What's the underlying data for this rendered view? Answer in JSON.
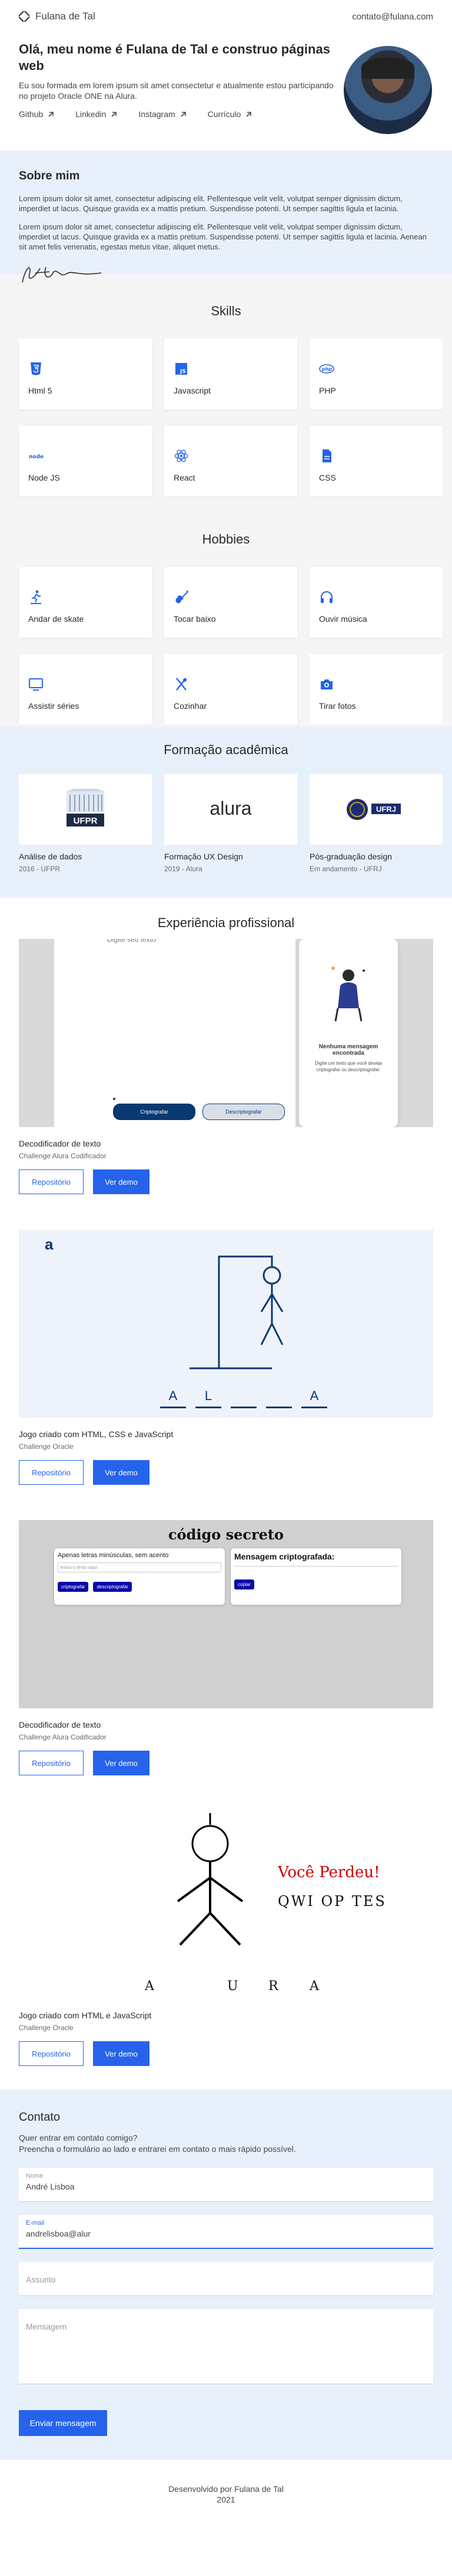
{
  "header": {
    "brand": "Fulana de Tal",
    "email": "contato@fulana.com"
  },
  "hero": {
    "title": "Olá, meu nome é Fulana de Tal e construo páginas web",
    "text": "Eu sou formada em lorem ipsum sit amet consectetur e atualmente estou participando no projeto Oracle ONE na Alura.",
    "links": [
      "Github",
      "Linkedin",
      "Instagram",
      "Currículo"
    ]
  },
  "about": {
    "title": "Sobre mim",
    "p1": "Lorem ipsum dolor sit amet, consectetur adipiscing elit. Pellentesque velit velit, volutpat semper dignissim dictum, imperdiet ut lacus. Quisque gravida ex a mattis pretium. Suspendisse potenti. Ut semper sagittis ligula et lacinia.",
    "p2": "Lorem ipsum dolor sit amet, consectetur adipiscing elit. Pellentesque velit velit, volutpat semper dignissim dictum, imperdiet ut lacus. Quisque gravida ex a mattis pretium. Suspendisse potenti. Ut semper sagittis ligula et lacinia. Aenean sit amet felis venenatis, egestas metus vitae, aliquet metus."
  },
  "skills": {
    "title": "Skills",
    "items": [
      {
        "label": "Html 5",
        "icon": "html5-icon"
      },
      {
        "label": "Javascript",
        "icon": "javascript-icon"
      },
      {
        "label": "PHP",
        "icon": "php-icon"
      },
      {
        "label": "Node JS",
        "icon": "nodejs-icon"
      },
      {
        "label": "React",
        "icon": "react-icon"
      },
      {
        "label": "CSS",
        "icon": "css-icon"
      }
    ]
  },
  "hobbies": {
    "title": "Hobbies",
    "items": [
      {
        "label": "Andar de skate",
        "icon": "skate-icon"
      },
      {
        "label": "Tocar baixo",
        "icon": "guitar-icon"
      },
      {
        "label": "Ouvir música",
        "icon": "headphones-icon"
      },
      {
        "label": "Assistir séries",
        "icon": "tv-icon"
      },
      {
        "label": "Cozinhar",
        "icon": "utensils-icon"
      },
      {
        "label": "Tirar fotos",
        "icon": "camera-icon"
      }
    ]
  },
  "education": {
    "title": "Formação acadêmica",
    "items": [
      {
        "logo": "UFPR",
        "title": "Análise de dados",
        "sub": "2016 - UFPR"
      },
      {
        "logo": "alura",
        "title": "Formação UX Design",
        "sub": "2019 - Alura"
      },
      {
        "logo": "UFRJ",
        "title": "Pós-graduação design",
        "sub": "Em andamento - UFRJ"
      }
    ]
  },
  "experience": {
    "title": "Experiência profissional",
    "repo_label": "Repositório",
    "demo_label": "Ver demo",
    "projects": [
      {
        "title": "Decodificador de texto",
        "sub": "Challenge Alura Codificador",
        "shot": {
          "top_text": "Digite seu texto",
          "empty_title": "Nenhuma mensagem encontrada",
          "empty_text": "Digite um texto que você deseja criptografar ou descriptografar.",
          "btn1": "Criptografar",
          "btn2": "Descriptografar"
        }
      },
      {
        "title": "Jogo criado com HTML, CSS e JavaScript",
        "sub": "Challenge Oracle",
        "shot": {
          "logo": "a",
          "letters": [
            "A",
            "L",
            "",
            "",
            "A"
          ]
        }
      },
      {
        "title": "Decodificador de texto",
        "sub": "Challenge Alura Codificador",
        "shot": {
          "heading": "código secreto",
          "input_hint": "Apenas letras minúsculas, sem acento",
          "input_ph": "Insira o texto aqui",
          "btn1": "criptografar",
          "btn2": "descriptografar",
          "result_title": "Mensagem criptografada:",
          "copy": "copiar"
        }
      },
      {
        "title": "Jogo criado com HTML e JavaScript",
        "sub": "Challenge Oracle",
        "shot": {
          "lost": "Você Perdeu!",
          "wrong": "QWI OP TES",
          "letters": [
            "A",
            "",
            "U",
            "R",
            "A"
          ]
        }
      }
    ]
  },
  "contact": {
    "title": "Contato",
    "text1": "Quer entrar em contato comigo?",
    "text2": "Preencha o formulário ao lado e entrarei em contato o mais rápido possível.",
    "name_label": "Nome",
    "name_value": "André Lisboa",
    "email_label": "E-mail",
    "email_value": "andrelisboa@alur",
    "subject_ph": "Assunto",
    "message_ph": "Mensagem",
    "send": "Enviar mensagem"
  },
  "footer": {
    "line1": "Desenvolvido por Fulana de Tal",
    "line2": "2021"
  },
  "colors": {
    "accent": "#2563eb",
    "light_bg": "#e8f0fc",
    "gray_bg": "#f5f5f5"
  }
}
